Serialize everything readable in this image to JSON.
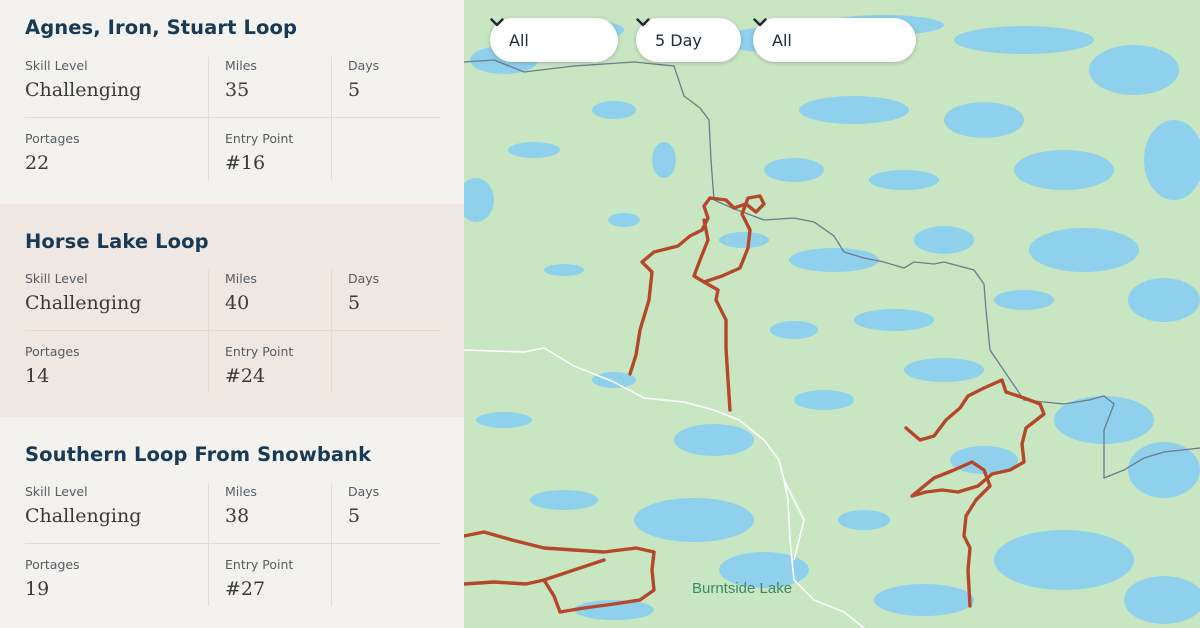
{
  "routes": [
    {
      "title": "Agnes, Iron, Stuart Loop",
      "skill_label": "Skill Level",
      "skill": "Challenging",
      "miles_label": "Miles",
      "miles": "35",
      "days_label": "Days",
      "days": "5",
      "portages_label": "Portages",
      "portages": "22",
      "entry_label": "Entry Point",
      "entry": "#16"
    },
    {
      "title": "Horse Lake Loop",
      "skill_label": "Skill Level",
      "skill": "Challenging",
      "miles_label": "Miles",
      "miles": "40",
      "days_label": "Days",
      "days": "5",
      "portages_label": "Portages",
      "portages": "14",
      "entry_label": "Entry Point",
      "entry": "#24"
    },
    {
      "title": "Southern Loop From Snowbank",
      "skill_label": "Skill Level",
      "skill": "Challenging",
      "miles_label": "Miles",
      "miles": "38",
      "days_label": "Days",
      "days": "5",
      "portages_label": "Portages",
      "portages": "19",
      "entry_label": "Entry Point",
      "entry": "#27"
    }
  ],
  "filters": [
    {
      "value": "All",
      "icon": "chevron-down-icon"
    },
    {
      "value": "5 Day",
      "icon": "chevron-down-icon"
    },
    {
      "value": "All",
      "icon": "chevron-down-icon"
    }
  ],
  "map": {
    "place_label": "Burntside Lake",
    "colors": {
      "land": "#c8e6c2",
      "water": "#8fd0ec",
      "route": "#b5472b",
      "border": "#6c7c8c",
      "road": "#ffffff"
    }
  }
}
